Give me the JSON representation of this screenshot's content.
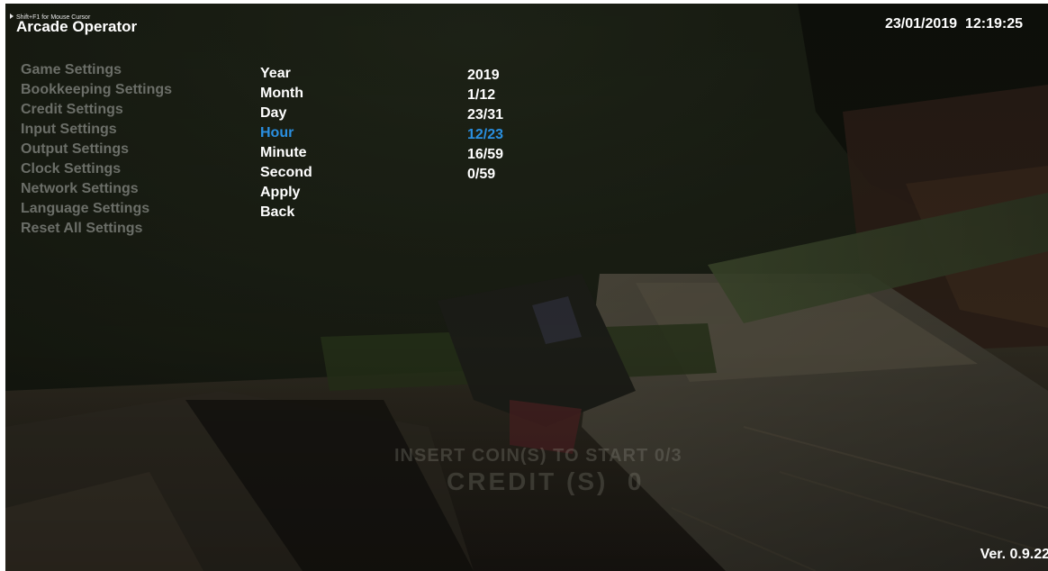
{
  "hint": {
    "mouse_cursor": "Shift+F1 for Mouse Cursor",
    "icon": "play-triangle-icon"
  },
  "header": {
    "title": "Arcade Operator",
    "datetime": "23/01/2019  12:19:25"
  },
  "categories": [
    {
      "label": "Game Settings"
    },
    {
      "label": "Bookkeeping Settings"
    },
    {
      "label": "Credit Settings"
    },
    {
      "label": "Input Settings"
    },
    {
      "label": "Output Settings"
    },
    {
      "label": "Clock Settings"
    },
    {
      "label": "Network Settings"
    },
    {
      "label": "Language Settings"
    },
    {
      "label": "Reset All Settings"
    }
  ],
  "clock": {
    "options": [
      {
        "label": "Year",
        "value": "2019"
      },
      {
        "label": "Month",
        "value": "1/12"
      },
      {
        "label": "Day",
        "value": "23/31"
      },
      {
        "label": "Hour",
        "value": "12/23"
      },
      {
        "label": "Minute",
        "value": "16/59"
      },
      {
        "label": "Second",
        "value": "0/59"
      },
      {
        "label": "Apply"
      },
      {
        "label": "Back"
      }
    ],
    "selected_option": "Hour"
  },
  "attract": {
    "insert_coin": "INSERT COIN(S) TO START 0/3",
    "credit": "CREDIT (S)  0"
  },
  "footer": {
    "version": "Ver. 0.9.22"
  },
  "colors": {
    "selected": "#2a8fe0",
    "inactive_category": "#6b6e68",
    "text": "#ffffff"
  }
}
